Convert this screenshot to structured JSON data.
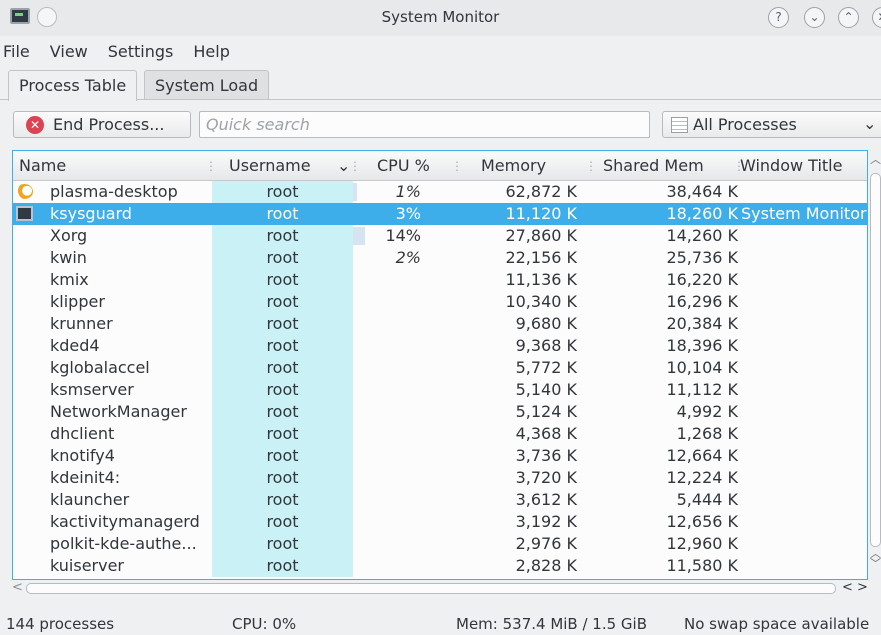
{
  "window": {
    "title": "System Monitor"
  },
  "menu": [
    {
      "label": "File"
    },
    {
      "label": "View"
    },
    {
      "label": "Settings"
    },
    {
      "label": "Help"
    }
  ],
  "tabs": [
    {
      "label": "Process Table",
      "active": true
    },
    {
      "label": "System Load",
      "active": false
    }
  ],
  "toolbar": {
    "end_process_label": "End Process...",
    "search_placeholder": "Quick search",
    "filter_value": "All Processes"
  },
  "columns": {
    "name": "Name",
    "username": "Username",
    "cpu": "CPU %",
    "memory": "Memory",
    "shared": "Shared Mem",
    "window_title": "Window Title"
  },
  "rows": [
    {
      "name": "plasma-desktop",
      "user": "root",
      "cpu": "1%",
      "cpu_italic": true,
      "mem": "62,872 K",
      "shared": "38,464 K",
      "window": "",
      "icon": "plasma-icon"
    },
    {
      "name": "ksysguard",
      "user": "root",
      "cpu": "3%",
      "cpu_italic": false,
      "mem": "11,120 K",
      "shared": "18,260 K",
      "window": "System Monitor",
      "icon": "system-monitor-icon",
      "selected": true
    },
    {
      "name": "Xorg",
      "user": "root",
      "cpu": "14%",
      "cpu_italic": false,
      "mem": "27,860 K",
      "shared": "14,260 K",
      "window": ""
    },
    {
      "name": "kwin",
      "user": "root",
      "cpu": "2%",
      "cpu_italic": true,
      "mem": "22,156 K",
      "shared": "25,736 K",
      "window": ""
    },
    {
      "name": "kmix",
      "user": "root",
      "cpu": "",
      "mem": "11,136 K",
      "shared": "16,220 K",
      "window": ""
    },
    {
      "name": "klipper",
      "user": "root",
      "cpu": "",
      "mem": "10,340 K",
      "shared": "16,296 K",
      "window": ""
    },
    {
      "name": "krunner",
      "user": "root",
      "cpu": "",
      "mem": "9,680 K",
      "shared": "20,384 K",
      "window": ""
    },
    {
      "name": "kded4",
      "user": "root",
      "cpu": "",
      "mem": "9,368 K",
      "shared": "18,396 K",
      "window": ""
    },
    {
      "name": "kglobalaccel",
      "user": "root",
      "cpu": "",
      "mem": "5,772 K",
      "shared": "10,104 K",
      "window": ""
    },
    {
      "name": "ksmserver",
      "user": "root",
      "cpu": "",
      "mem": "5,140 K",
      "shared": "11,112 K",
      "window": ""
    },
    {
      "name": "NetworkManager",
      "user": "root",
      "cpu": "",
      "mem": "5,124 K",
      "shared": "4,992 K",
      "window": ""
    },
    {
      "name": "dhclient",
      "user": "root",
      "cpu": "",
      "mem": "4,368 K",
      "shared": "1,268 K",
      "window": ""
    },
    {
      "name": "knotify4",
      "user": "root",
      "cpu": "",
      "mem": "3,736 K",
      "shared": "12,664 K",
      "window": ""
    },
    {
      "name": "kdeinit4:",
      "user": "root",
      "cpu": "",
      "mem": "3,720 K",
      "shared": "12,224 K",
      "window": ""
    },
    {
      "name": "klauncher",
      "user": "root",
      "cpu": "",
      "mem": "3,612 K",
      "shared": "5,444 K",
      "window": ""
    },
    {
      "name": "kactivitymanagerd",
      "user": "root",
      "cpu": "",
      "mem": "3,192 K",
      "shared": "12,656 K",
      "window": ""
    },
    {
      "name": "polkit-kde-authe...",
      "user": "root",
      "cpu": "",
      "mem": "2,976 K",
      "shared": "12,960 K",
      "window": ""
    },
    {
      "name": "kuiserver",
      "user": "root",
      "cpu": "",
      "mem": "2,828 K",
      "shared": "11,580 K",
      "window": ""
    }
  ],
  "status": {
    "processes": "144 processes",
    "cpu": "CPU: 0%",
    "mem": "Mem: 537.4 MiB / 1.5 GiB",
    "swap": "No swap space available"
  },
  "colors": {
    "selection": "#3daee9",
    "username_band": "#c9f1f6",
    "end_icon": "#da4453"
  }
}
